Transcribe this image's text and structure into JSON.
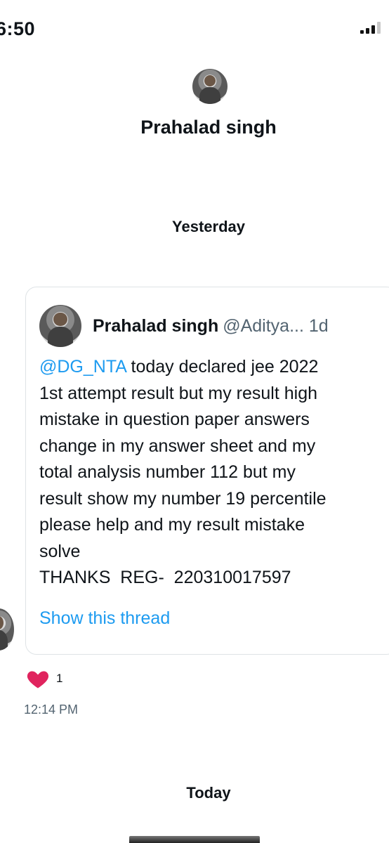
{
  "status_bar": {
    "time": "6:50"
  },
  "conversation": {
    "name": "Prahalad singh"
  },
  "day_labels": {
    "yesterday": "Yesterday",
    "today": "Today"
  },
  "tweet": {
    "author_name": "Prahalad singh",
    "author_handle_time": "@Aditya... 1d",
    "mention": "@DG_NTA",
    "lines": [
      " today declared jee 2022",
      "1st attempt result but my result high",
      "mistake in question paper answers",
      "change in my answer sheet and my",
      "total analysis number 112 but my",
      "result show my number 19 percentile",
      "please help and my result mistake",
      "solve",
      "THANKS  REG-  220310017597"
    ],
    "show_thread": "Show this thread"
  },
  "reactions": {
    "icon": "heart-icon",
    "count": "1",
    "color": "#e0245e"
  },
  "message_time": "12:14 PM",
  "colors": {
    "link": "#1d9bf0",
    "secondary_text": "#536471"
  }
}
